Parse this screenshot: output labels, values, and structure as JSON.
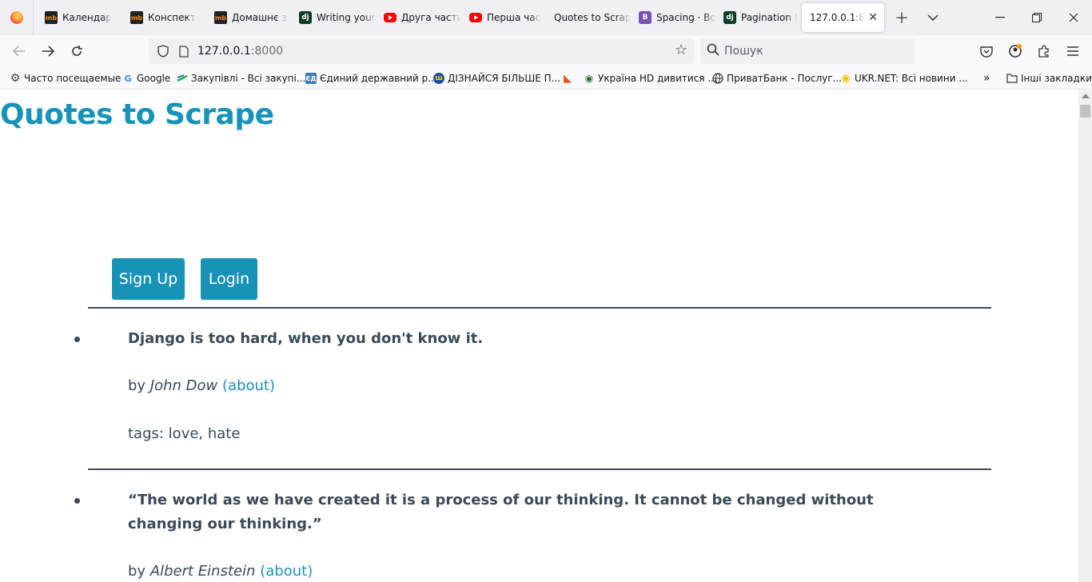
{
  "browser": {
    "tabs": [
      {
        "label": "Календар",
        "favicon": "mb"
      },
      {
        "label": "Конспект",
        "favicon": "mb"
      },
      {
        "label": "Домашнє з",
        "favicon": "mb"
      },
      {
        "label": "Writing your",
        "favicon": "dj"
      },
      {
        "label": "Друга части",
        "favicon": "yt"
      },
      {
        "label": "Перша час",
        "favicon": "yt"
      },
      {
        "label": "Quotes to Scrap",
        "favicon": "none"
      },
      {
        "label": "Spacing · Bo",
        "favicon": "bs"
      },
      {
        "label": "Pagination |",
        "favicon": "dj"
      },
      {
        "label": "127.0.0.1:8000",
        "favicon": "none",
        "active": true
      }
    ],
    "url": {
      "host": "127.0.0.1",
      "port": ":8000"
    },
    "search_placeholder": "Пошук",
    "bookmarks": [
      {
        "label": "Часто посещаемые",
        "icon": "gear-icon"
      },
      {
        "label": "Google",
        "icon": "google-icon"
      },
      {
        "label": "Закупівлі - Всі закупі...",
        "icon": "prozorro-icon"
      },
      {
        "label": "Єдиний державний р...",
        "icon": "registry-icon"
      },
      {
        "label": "ДІЗНАЙСЯ БІЛЬШЕ П...",
        "icon": "trident-icon"
      },
      {
        "label": "",
        "icon": "fox-icon"
      },
      {
        "label": "Україна HD дивитися ...",
        "icon": "tv-icon"
      },
      {
        "label": "ПриватБанк - Послуг...",
        "icon": "globe-icon"
      },
      {
        "label": "UKR.NET: Всі новини ...",
        "icon": "ukrnet-icon"
      }
    ],
    "other_bookmarks": "Інші закладки",
    "accent": "#1893b8"
  },
  "page": {
    "title": "Quotes to Scrape",
    "buttons": {
      "signup": "Sign Up",
      "login": "Login"
    },
    "quotes": [
      {
        "text": "Django is too hard, when you don't know it.",
        "by_prefix": "by",
        "author": "John Dow",
        "about": "(about)",
        "tags": "tags: love, hate"
      },
      {
        "text": "“The world as we have created it is a process of our thinking. It cannot be changed without changing our thinking.”",
        "by_prefix": "by",
        "author": "Albert Einstein",
        "about": "(about)"
      }
    ]
  }
}
